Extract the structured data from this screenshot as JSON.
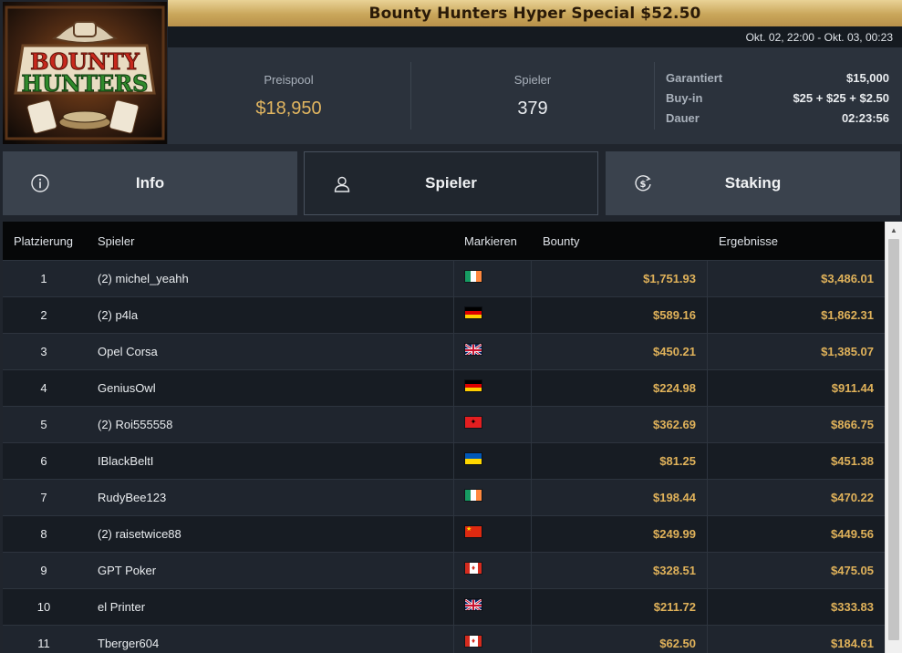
{
  "logo": {
    "line1": "BOUNTY",
    "line2": "HUNTERS"
  },
  "title": "Bounty Hunters Hyper Special $52.50",
  "date_range": "Okt. 02, 22:00 - Okt. 03, 00:23",
  "stats": {
    "prizepool_label": "Preispool",
    "prizepool_value": "$18,950",
    "players_label": "Spieler",
    "players_value": "379",
    "guaranteed_label": "Garantiert",
    "guaranteed_value": "$15,000",
    "buyin_label": "Buy-in",
    "buyin_value": "$25 + $25 + $2.50",
    "duration_label": "Dauer",
    "duration_value": "02:23:56"
  },
  "tabs": [
    {
      "label": "Info",
      "icon": "info-icon"
    },
    {
      "label": "Spieler",
      "icon": "user-icon",
      "active": true
    },
    {
      "label": "Staking",
      "icon": "dollar-cycle-icon"
    }
  ],
  "table": {
    "headers": [
      "Platzierung",
      "Spieler",
      "Markieren",
      "Bounty",
      "Ergebnisse"
    ],
    "rows": [
      {
        "place": "1",
        "player": "(2) michel_yeahh",
        "flag": "ireland",
        "bounty": "$1,751.93",
        "result": "$3,486.01"
      },
      {
        "place": "2",
        "player": "(2) p4la",
        "flag": "germany",
        "bounty": "$589.16",
        "result": "$1,862.31"
      },
      {
        "place": "3",
        "player": "Opel Corsa",
        "flag": "uk",
        "bounty": "$450.21",
        "result": "$1,385.07"
      },
      {
        "place": "4",
        "player": "GeniusOwl",
        "flag": "germany",
        "bounty": "$224.98",
        "result": "$911.44"
      },
      {
        "place": "5",
        "player": "(2) Roi555558",
        "flag": "albania",
        "bounty": "$362.69",
        "result": "$866.75"
      },
      {
        "place": "6",
        "player": "IBlackBeltI",
        "flag": "ukraine",
        "bounty": "$81.25",
        "result": "$451.38"
      },
      {
        "place": "7",
        "player": "RudyBee123",
        "flag": "ireland",
        "bounty": "$198.44",
        "result": "$470.22"
      },
      {
        "place": "8",
        "player": "(2) raisetwice88",
        "flag": "china",
        "bounty": "$249.99",
        "result": "$449.56"
      },
      {
        "place": "9",
        "player": "GPT Poker",
        "flag": "canada",
        "bounty": "$328.51",
        "result": "$475.05"
      },
      {
        "place": "10",
        "player": "el Printer",
        "flag": "uk",
        "bounty": "$211.72",
        "result": "$333.83"
      },
      {
        "place": "11",
        "player": "Tberger604",
        "flag": "canada",
        "bounty": "$62.50",
        "result": "$184.61"
      }
    ]
  },
  "colors": {
    "gold": "#e0b25a",
    "title_gold": "#c9a65a",
    "panel": "#2b323c",
    "tab": "#3a424d"
  }
}
